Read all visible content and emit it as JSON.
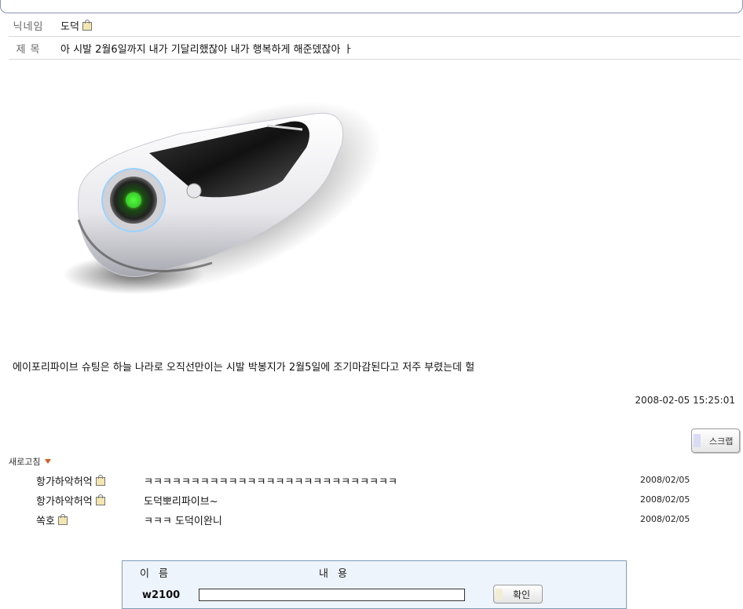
{
  "header": {
    "nickname_label": "닉네임",
    "nickname_value": "도덕",
    "subject_label": "제 목",
    "subject_value": "아 시발 2월6일까지 내가 기달리했잖아 내가 행복하게 해준뎄잖아 ㅏ"
  },
  "post": {
    "body": "에이포리파이브 슈팅은 하늘 나라로 오직선만이는 시발 박봉지가 2월5일에 조기마감된다고 저주 부렸는데 헐",
    "datetime": "2008-02-05 15:25:01",
    "scrap_label": "스크랩"
  },
  "comments_header": {
    "refresh_label": "새로고침"
  },
  "comments": [
    {
      "author": "항가하악허억",
      "text": "ㅋㅋㅋㅋㅋㅋㅋㅋㅋㅋㅋㅋㅋㅋㅋㅋㅋㅋㅋㅋㅋㅋㅋㅋㅋㅋㅋ",
      "date": "2008/02/05"
    },
    {
      "author": "항가하악허억",
      "text": "도덕뽀리파이브~",
      "date": "2008/02/05"
    },
    {
      "author": "쏙호",
      "text": "ㅋㅋㅋ 도덕이완니",
      "date": "2008/02/05"
    }
  ],
  "comment_form": {
    "name_header": "이름",
    "content_header": "내용",
    "name_value": "w2100",
    "content_value": "",
    "submit_label": "확인"
  }
}
